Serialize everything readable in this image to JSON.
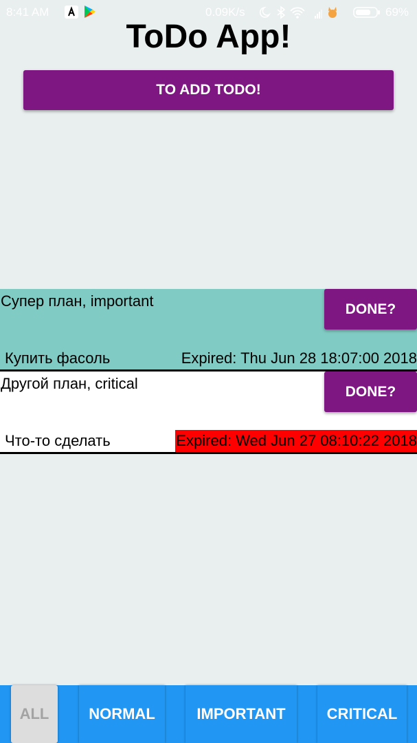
{
  "status_bar": {
    "time": "8:41 AM",
    "network_speed": "0.09K/s",
    "battery": "69%",
    "icons": [
      "notification-app-icon",
      "play-store-icon",
      "moon-icon",
      "bluetooth-icon",
      "wifi-icon",
      "signal-icon",
      "cat-icon",
      "battery-icon"
    ]
  },
  "header": {
    "title": "ToDo App!",
    "add_button_label": "TO ADD TODO!"
  },
  "todos": [
    {
      "title": "Супер план, important",
      "description": "Купить фасоль",
      "expired": "Expired: Thu Jun 28 18:07:00 2018",
      "done_label": "DONE?",
      "priority": "important",
      "background_color": "#80cbc4"
    },
    {
      "title": "Другой план, critical",
      "description": "Что-то сделать",
      "expired": "Expired: Wed Jun 27 08:10:22 2018",
      "done_label": "DONE?",
      "priority": "critical",
      "background_color": "#ffffff",
      "expired_highlight_color": "#ff0000"
    }
  ],
  "filters": {
    "selected": "ALL",
    "items": [
      {
        "label": "ALL"
      },
      {
        "label": "NORMAL"
      },
      {
        "label": "IMPORTANT"
      },
      {
        "label": "CRITICAL"
      }
    ]
  },
  "colors": {
    "accent": "#7f1783",
    "filter_bar": "#2196f3",
    "background": "#e9eeee"
  }
}
